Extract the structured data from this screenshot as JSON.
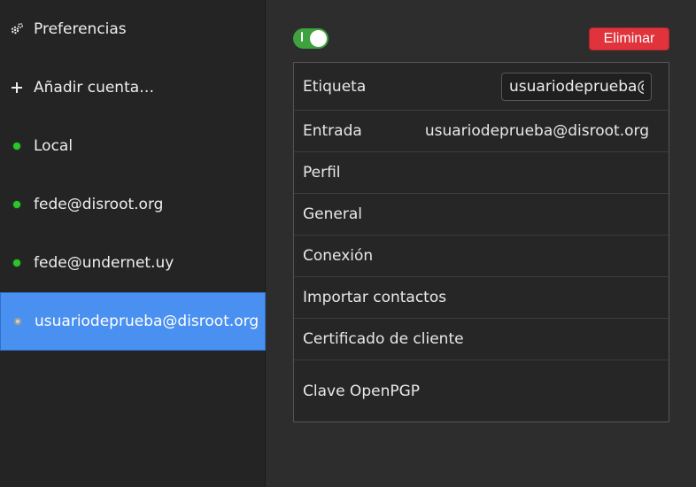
{
  "sidebar": {
    "items": [
      {
        "label": "Preferencias",
        "icon": "gear-icon"
      },
      {
        "label": "Añadir cuenta…",
        "icon": "plus-icon"
      },
      {
        "label": "Local",
        "icon": "status-online-dot",
        "status": "online"
      },
      {
        "label": "fede@disroot.org",
        "icon": "status-online-dot",
        "status": "online"
      },
      {
        "label": "fede@undernet.uy",
        "icon": "status-online-dot",
        "status": "online"
      },
      {
        "label": "usuariodeprueba@disroot.org",
        "icon": "status-offline-dot",
        "status": "offline",
        "selected": true
      }
    ]
  },
  "account": {
    "enabled": true,
    "delete_label": "Eliminar",
    "rows": [
      {
        "label": "Etiqueta",
        "input_value": "usuariodeprueba@"
      },
      {
        "label": "Entrada",
        "value": "usuariodeprueba@disroot.org"
      },
      {
        "label": "Perfil"
      },
      {
        "label": "General"
      },
      {
        "label": "Conexión"
      },
      {
        "label": "Importar contactos"
      },
      {
        "label": "Certificado de cliente"
      },
      {
        "label": "Clave OpenPGP"
      }
    ]
  },
  "colors": {
    "accent": "#4a90f0",
    "danger": "#e0333c",
    "toggle_on": "#3ea33e",
    "status_online": "#2cc52c"
  }
}
